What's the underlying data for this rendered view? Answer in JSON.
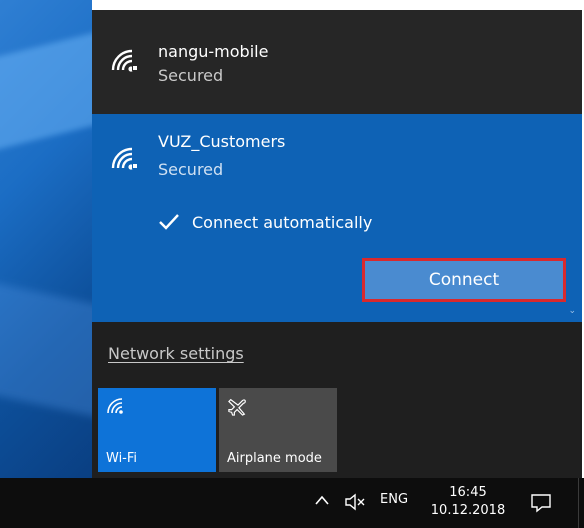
{
  "networks": [
    {
      "name": "nangu-mobile",
      "status": "Secured",
      "icon": "wifi-secured-icon"
    },
    {
      "name": "VUZ_Customers",
      "status": "Secured",
      "icon": "wifi-secured-icon",
      "selected": true,
      "connect_automatically": {
        "label": "Connect automatically",
        "checked": true
      },
      "connect_button_label": "Connect"
    }
  ],
  "network_settings_link": "Network settings",
  "quick_actions": [
    {
      "label": "Wi-Fi",
      "icon": "wifi-icon",
      "active": true
    },
    {
      "label": "Airplane mode",
      "icon": "airplane-icon",
      "active": false
    }
  ],
  "taskbar": {
    "language": "ENG",
    "time": "16:45",
    "date": "10.12.2018",
    "icons": [
      "chevron-up-icon",
      "volume-muted-icon",
      "action-center-icon"
    ]
  },
  "colors": {
    "accent": "#0e62b5",
    "flyout_bg": "#1f1f1f",
    "tile_active": "#0e73d8",
    "tile_inactive": "#4a4a4a",
    "highlight_border": "#d9292d",
    "taskbar_bg": "#0d0d0d"
  }
}
